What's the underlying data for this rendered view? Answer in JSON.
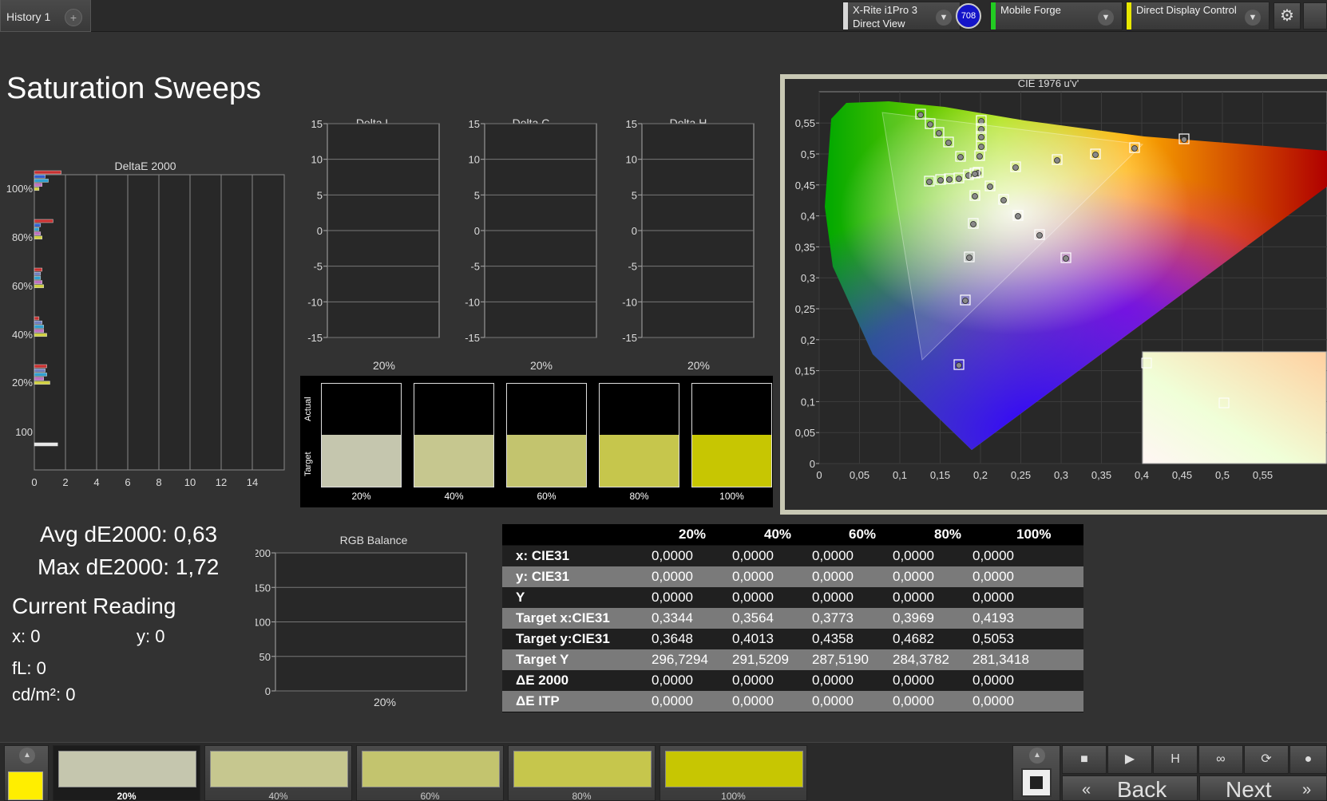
{
  "tabs": {
    "history_label": "History 1",
    "add_label": "+"
  },
  "devices": {
    "meter_line1": "X-Rite i1Pro 3",
    "meter_line2": "Direct View",
    "meter_color": "#d8d8d8",
    "badge": "708",
    "generator": "Mobile Forge",
    "generator_color": "#22cc22",
    "display": "Direct Display Control",
    "display_color": "#e8e800"
  },
  "page_title": "Saturation Sweeps",
  "stats": {
    "avg": "Avg dE2000: 0,63",
    "max": "Max dE2000: 1,72",
    "current_reading": "Current Reading",
    "x": "x: 0",
    "y": "y: 0",
    "fl": "fL: 0",
    "cdm2": "cd/m²: 0"
  },
  "deltae_chart": {
    "title": "DeltaE 2000",
    "y_labels": [
      "100%",
      "80%",
      "60%",
      "40%",
      "20%",
      "100"
    ],
    "x_ticks": [
      "0",
      "2",
      "4",
      "6",
      "8",
      "10",
      "12",
      "14"
    ],
    "bars": [
      {
        "group": "100%",
        "values": [
          1.72,
          0.7,
          0.9,
          0.5,
          0.3
        ],
        "colors": [
          "#c83030",
          "#3060d0",
          "#30a0d0",
          "#c070c0",
          "#d0d040"
        ]
      },
      {
        "group": "80%",
        "values": [
          1.2,
          0.4,
          0.3,
          0.4,
          0.5
        ],
        "colors": [
          "#c83030",
          "#3060d0",
          "#30a0d0",
          "#c070c0",
          "#d0d040"
        ]
      },
      {
        "group": "60%",
        "values": [
          0.5,
          0.4,
          0.4,
          0.5,
          0.6
        ],
        "colors": [
          "#c83030",
          "#7080c0",
          "#30a0d0",
          "#c070c0",
          "#d0d040"
        ]
      },
      {
        "group": "40%",
        "values": [
          0.3,
          0.5,
          0.6,
          0.6,
          0.8
        ],
        "colors": [
          "#c83030",
          "#7080c0",
          "#30a0d0",
          "#c070c0",
          "#d0d040"
        ]
      },
      {
        "group": "20%",
        "values": [
          0.8,
          0.7,
          0.8,
          0.6,
          1.0
        ],
        "colors": [
          "#c83030",
          "#7080c0",
          "#30a0d0",
          "#c070c0",
          "#d0d040"
        ]
      },
      {
        "group": "100",
        "values": [
          1.5
        ],
        "colors": [
          "#e8e8e8"
        ]
      }
    ]
  },
  "delta_charts": [
    {
      "title": "Delta L",
      "x_label": "20%"
    },
    {
      "title": "Delta C",
      "x_label": "20%"
    },
    {
      "title": "Delta H",
      "x_label": "20%"
    }
  ],
  "delta_y_ticks": [
    "15",
    "10",
    "5",
    "0",
    "-5",
    "-10",
    "-15"
  ],
  "swatch_panel": {
    "actual_label": "Actual",
    "target_label": "Target",
    "items": [
      {
        "label": "20%",
        "target": "#c5c6ae"
      },
      {
        "label": "40%",
        "target": "#c6c78f"
      },
      {
        "label": "60%",
        "target": "#c3c46e"
      },
      {
        "label": "80%",
        "target": "#c6c64c"
      },
      {
        "label": "100%",
        "target": "#c7c602"
      }
    ]
  },
  "rgb_balance": {
    "title": "RGB Balance",
    "y_ticks": [
      "200",
      "150",
      "100",
      "50",
      "0"
    ],
    "x_label": "20%"
  },
  "cie": {
    "title": "CIE 1976 u'v'",
    "x_ticks": [
      "0",
      "0,05",
      "0,1",
      "0,15",
      "0,2",
      "0,25",
      "0,3",
      "0,35",
      "0,4",
      "0,45",
      "0,5",
      "0,55"
    ],
    "y_ticks": [
      "0",
      "0,05",
      "0,1",
      "0,15",
      "0,2",
      "0,25",
      "0,3",
      "0,35",
      "0,4",
      "0,45",
      "0,5",
      "0,55"
    ]
  },
  "table": {
    "columns": [
      "20%",
      "40%",
      "60%",
      "80%",
      "100%"
    ],
    "rows": [
      {
        "label": "x: CIE31",
        "values": [
          "0,0000",
          "0,0000",
          "0,0000",
          "0,0000",
          "0,0000"
        ]
      },
      {
        "label": "y: CIE31",
        "values": [
          "0,0000",
          "0,0000",
          "0,0000",
          "0,0000",
          "0,0000"
        ]
      },
      {
        "label": "Y",
        "values": [
          "0,0000",
          "0,0000",
          "0,0000",
          "0,0000",
          "0,0000"
        ]
      },
      {
        "label": "Target x:CIE31",
        "values": [
          "0,3344",
          "0,3564",
          "0,3773",
          "0,3969",
          "0,4193"
        ]
      },
      {
        "label": "Target y:CIE31",
        "values": [
          "0,3648",
          "0,4013",
          "0,4358",
          "0,4682",
          "0,5053"
        ]
      },
      {
        "label": "Target Y",
        "values": [
          "296,7294",
          "291,5209",
          "287,5190",
          "284,3782",
          "281,3418"
        ]
      },
      {
        "label": "ΔE 2000",
        "values": [
          "0,0000",
          "0,0000",
          "0,0000",
          "0,0000",
          "0,0000"
        ]
      },
      {
        "label": "ΔE ITP",
        "values": [
          "0,0000",
          "0,0000",
          "0,0000",
          "0,0000",
          "0,0000"
        ]
      }
    ]
  },
  "bottom": {
    "current_color": "#ffee00",
    "swatches": [
      {
        "label": "20%",
        "color": "#c5c6ae"
      },
      {
        "label": "40%",
        "color": "#c6c78f"
      },
      {
        "label": "60%",
        "color": "#c3c46e"
      },
      {
        "label": "80%",
        "color": "#c6c64c"
      },
      {
        "label": "100%",
        "color": "#c7c602"
      }
    ],
    "back_label": "Back",
    "next_label": "Next"
  }
}
